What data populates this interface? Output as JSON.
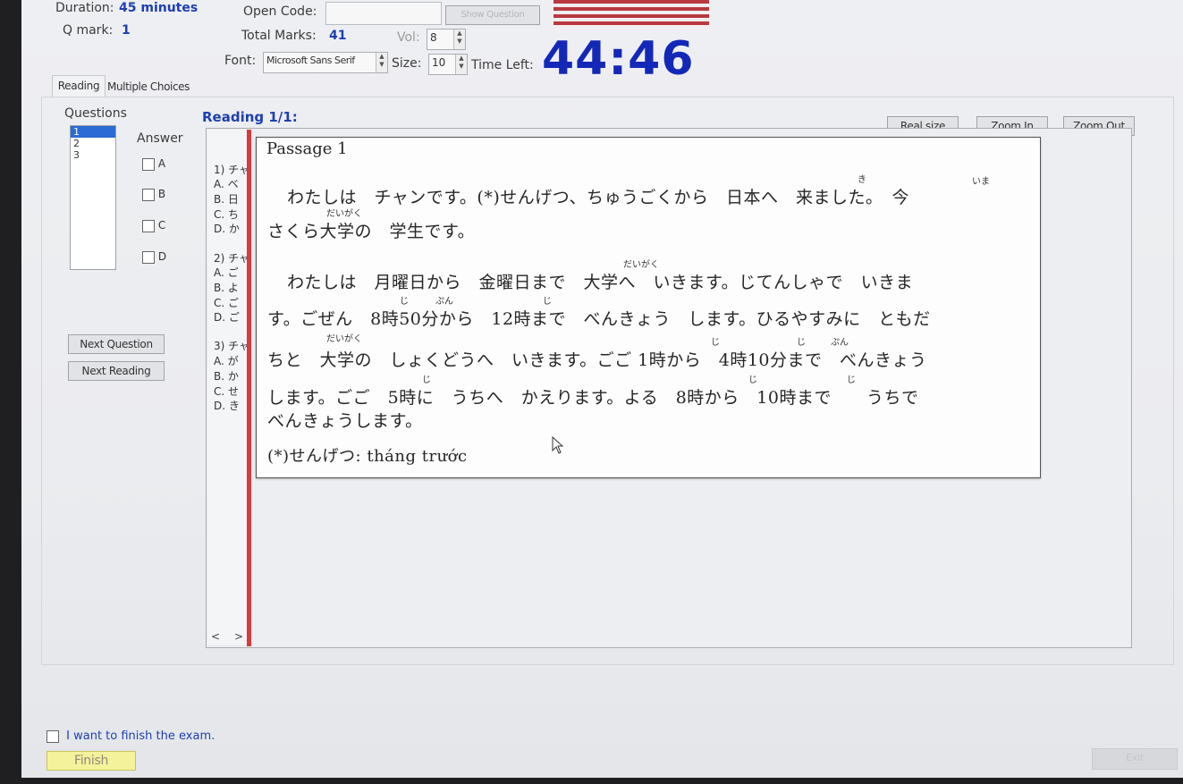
{
  "header": {
    "duration_label": "Duration:",
    "duration_value": "45 minutes",
    "qmark_label": "Q mark:",
    "qmark_value": "1",
    "open_code_label": "Open Code:",
    "show_question_label": "Show Question",
    "total_marks_label": "Total Marks:",
    "total_marks_value": "41",
    "vol_label": "Vol:",
    "vol_value": "8",
    "font_label": "Font:",
    "font_value": "Microsoft Sans Serif",
    "size_label": "Size:",
    "size_value": "10",
    "time_left_label": "Time Left:",
    "timer": "44:46"
  },
  "tabs": [
    {
      "label": "Reading",
      "active": true
    },
    {
      "label": "Multiple Choices",
      "active": false
    }
  ],
  "left_panel": {
    "questions_label": "Questions",
    "question_numbers": [
      "1",
      "2",
      "3"
    ],
    "answer_label": "Answer",
    "answers": [
      "A",
      "B",
      "C",
      "D"
    ],
    "next_question_label": "Next Question",
    "next_reading_label": "Next Reading"
  },
  "reading": {
    "heading": "Reading 1/1:",
    "real_size_label": "Real size",
    "zoom_in_label": "Zoom In",
    "zoom_out_label": "Zoom Out",
    "question_snippets": [
      [
        "1) チャ",
        "A. ベ",
        "B. 日",
        "C. ち",
        "D. か"
      ],
      [
        "2) チャ",
        "A. ご",
        "B. よ",
        "C. ご",
        "D. ご"
      ],
      [
        "3) チャ",
        "A. が",
        "B. か",
        "C. せ",
        "D. き"
      ]
    ],
    "scroll_left": "<",
    "scroll_right": ">"
  },
  "passage": {
    "title": "Passage 1",
    "line1": "わたしは　チャンです。(*)せんげつ、ちゅうごくから　日本へ　来ました。　今",
    "line2": "さくら大学の　学生です。",
    "line3": "わたしは　月曜日から　金曜日まで　大学へ　いきます。じてんしゃで　いきま",
    "line4": "す。ごぜん　8時50分から　12時まで　べんきょう　します。ひるやすみに　ともだ",
    "line5": "ちと　大学の　しょくどうへ　いきます。ごご 1時から　4時10分まで　べんきょう",
    "line6": "します。ごご　5時に　うちへ　かえります。よる　8時から　10時まで　　うちで",
    "line7": "べんきょうします。",
    "note": "(*)せんげつ:  tháng trước",
    "furigana": {
      "ki": "き",
      "ima": "いま",
      "daigaku": "だいがく",
      "ji": "じ",
      "fun": "ふん",
      "pun": "ぷん"
    }
  },
  "footer": {
    "finish_check_label": "I want to finish the exam.",
    "finish_button_label": "Finish",
    "exit_button_label": "Exit"
  }
}
